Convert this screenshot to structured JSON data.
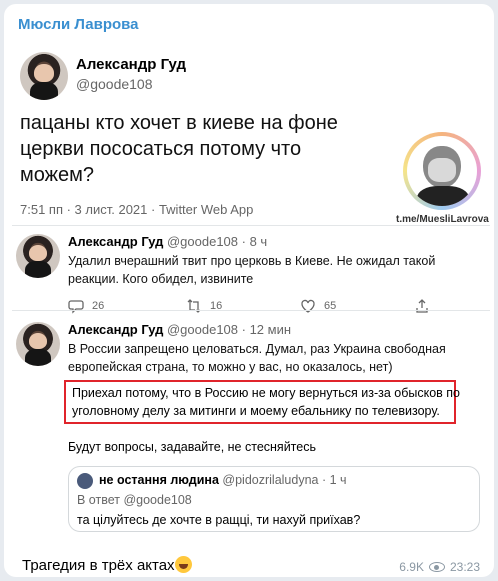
{
  "channel": {
    "name": "Мюсли Лаврова"
  },
  "main_tweet": {
    "name": "Александр Гуд",
    "handle": "@goode108",
    "text": "пацаны кто хочет в киеве на фоне церкви пососаться потому что можем?",
    "meta": "7:51 пп · 3 лист. 2021 · Twitter Web App"
  },
  "watermark": {
    "text": "t.me/MuesliLavrova"
  },
  "reply1": {
    "name": "Александр Гуд",
    "handle": "@goode108 · 8 ч",
    "text": "Удалил вчерашний твит про церковь в Киеве. Не ожидал такой реакции. Кого обидел, извините",
    "replies": "26",
    "retweets": "16",
    "likes": "65"
  },
  "reply2": {
    "name": "Александр Гуд",
    "handle": "@goode108 · 12 мин",
    "text": "В России запрещено целоваться. Думал, раз Украина свободная европейская страна, то можно у вас, но оказалось, нет)",
    "highlight": "Приехал потому, что в Россию не могу вернуться из-за обысков по уголовному делу за митинги и моему ебальнику по телевизору.",
    "questions": "Будут вопросы, задавайте, не стесняйтесь"
  },
  "quote": {
    "name": "не остання людина",
    "handle": "@pidozrilaludyna · 1 ч",
    "reply_to": "В ответ @goode108",
    "text": "та цілуйтесь де хочте в ращці, ти нахуй приїхав?"
  },
  "footer": {
    "caption": "Трагедия в трёх актах",
    "views": "6.9K",
    "time": "23:23"
  },
  "colors": {
    "channel": "#3a8fd0",
    "highlight_border": "#e0242b"
  }
}
